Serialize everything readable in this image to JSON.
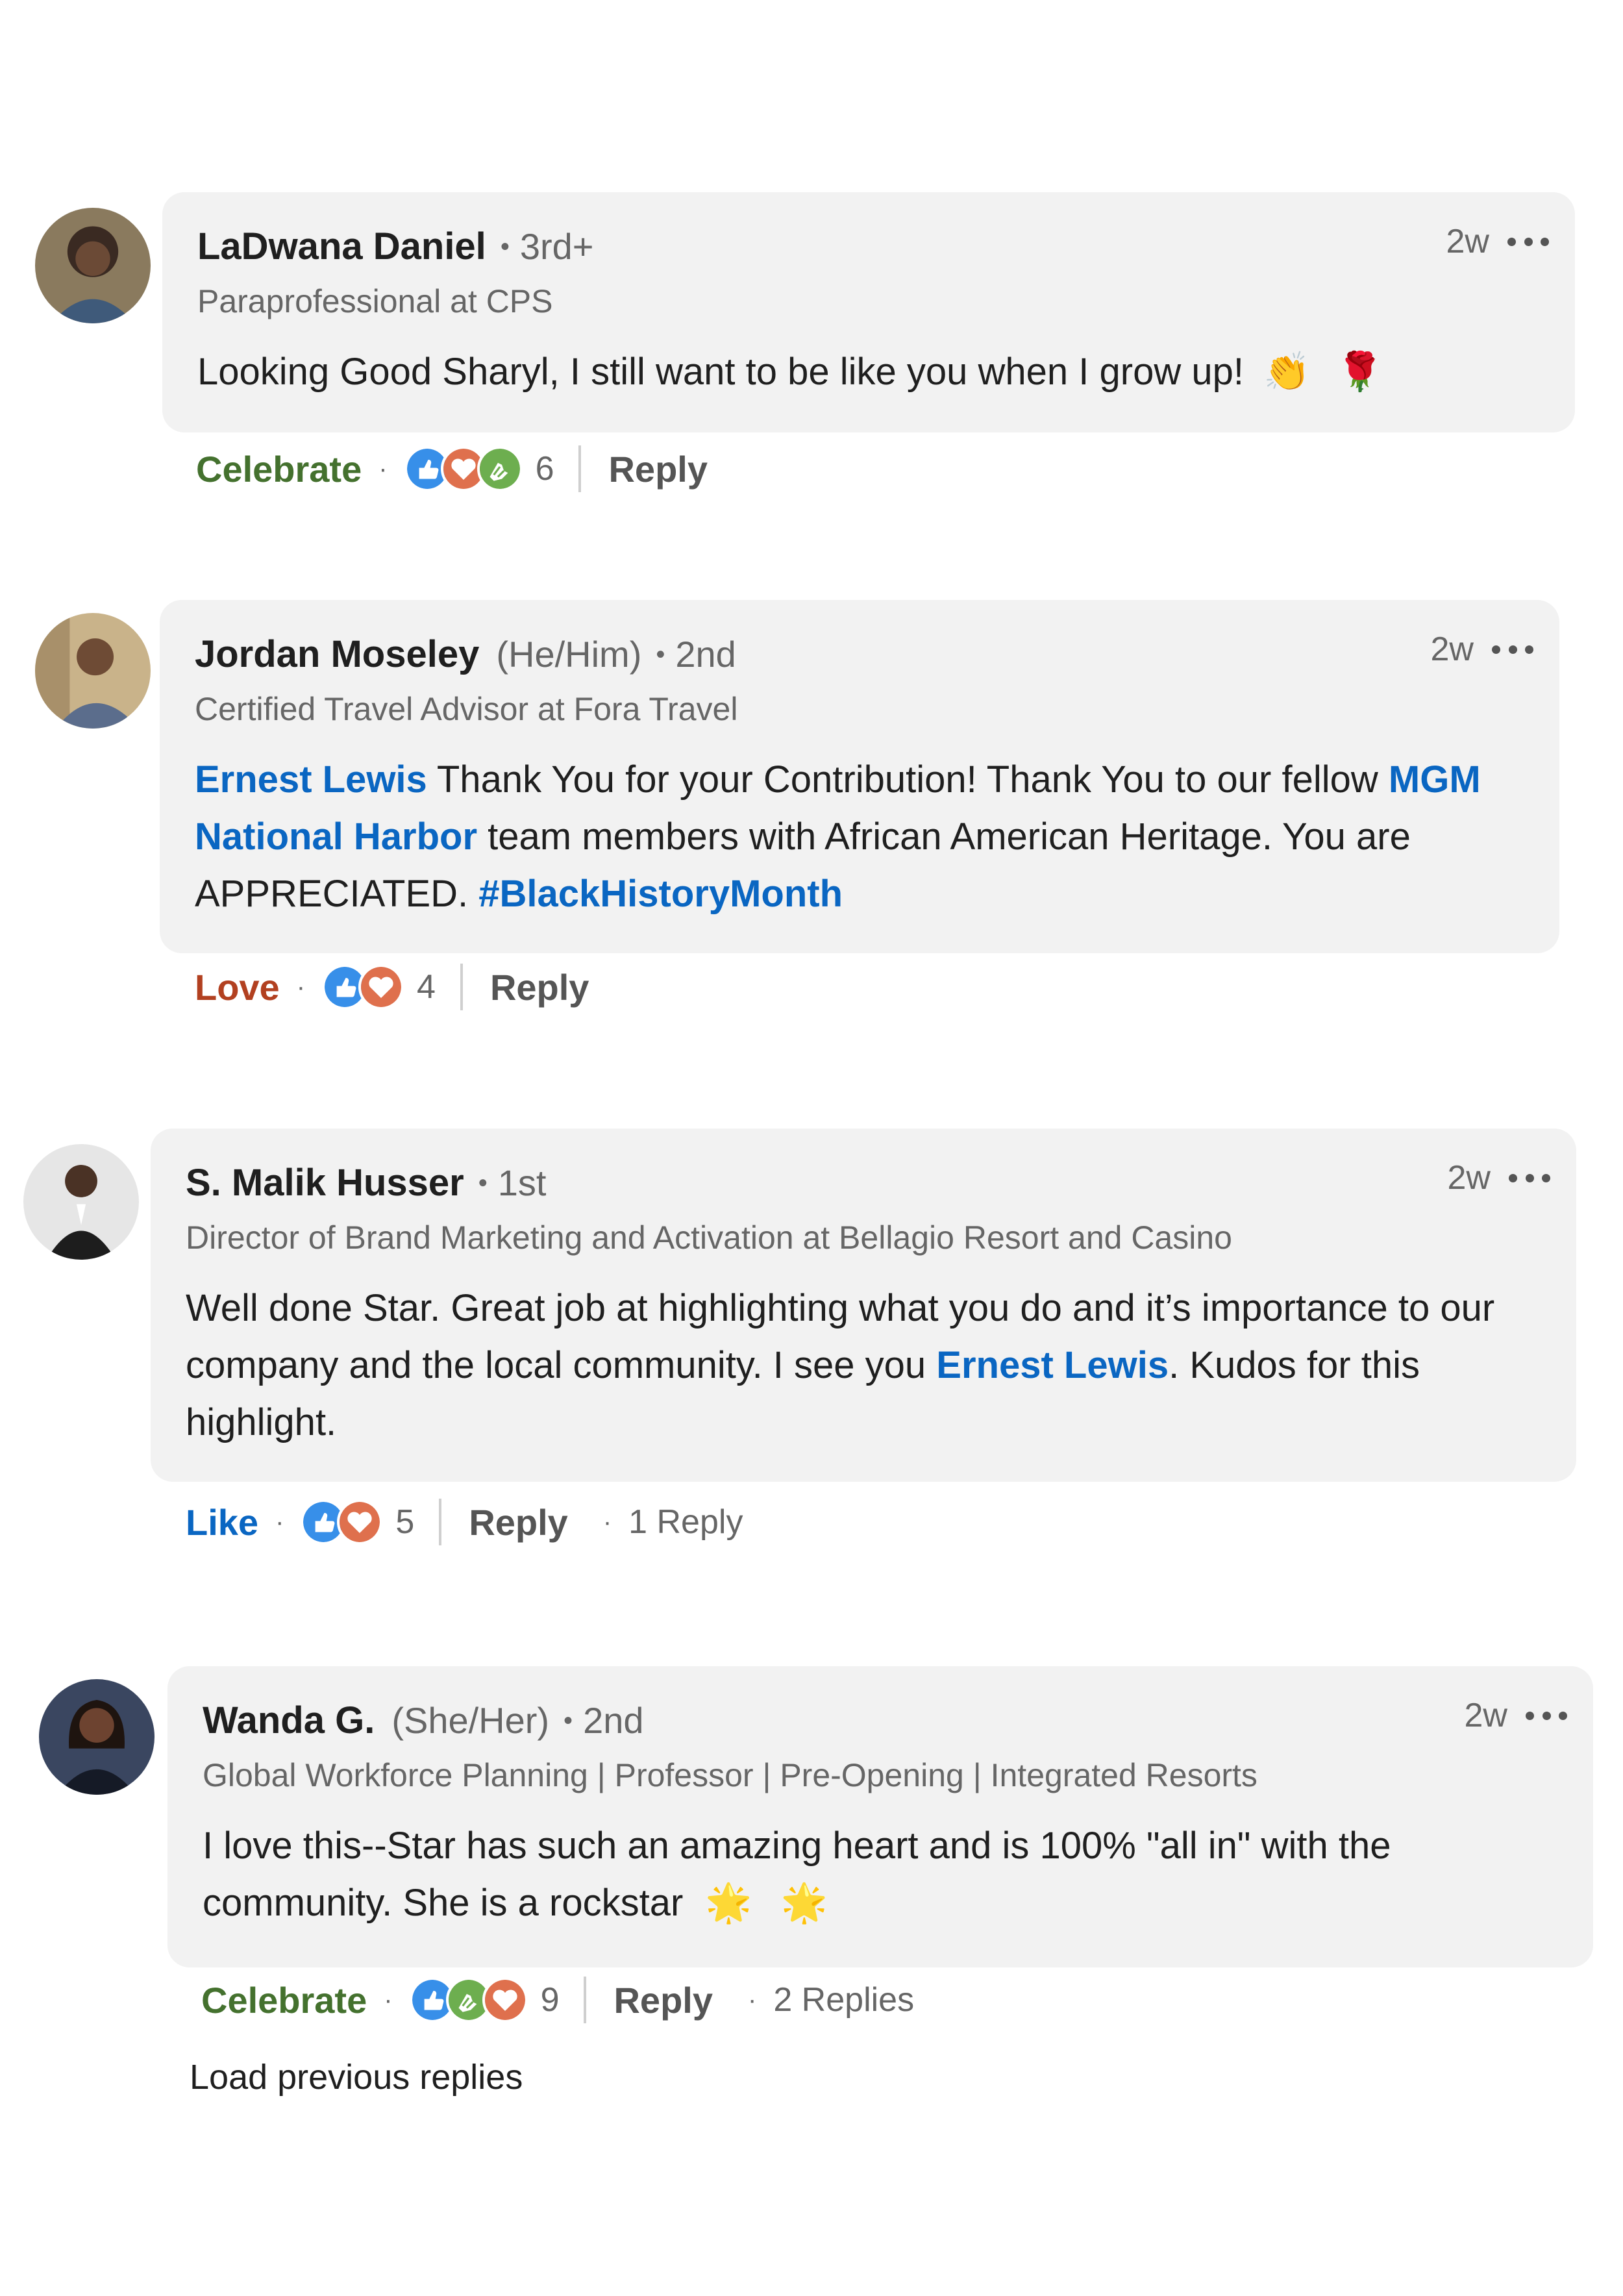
{
  "colors": {
    "bubble_bg": "#f2f2f2",
    "link": "#0a66c2",
    "celebrate": "#44712e",
    "love": "#b24020",
    "like": "#0a66c2",
    "muted": "#666666"
  },
  "comments": [
    {
      "name": "LaDwana Daniel",
      "pronouns": "",
      "degree": "3rd+",
      "subtitle": "Paraprofessional at CPS",
      "time": "2w",
      "text": "Looking Good Sharyl, I still want to be like you when I grow up!",
      "emojis": [
        "👏",
        "🌹"
      ],
      "reaction": "Celebrate",
      "reaction_icons": [
        "like",
        "love",
        "celebrate"
      ],
      "reaction_count": "6",
      "reply_label": "Reply",
      "replies": ""
    },
    {
      "name": "Jordan Moseley",
      "pronouns": "(He/Him)",
      "degree": "2nd",
      "subtitle": "Certified Travel Advisor at Fora Travel",
      "time": "2w",
      "text_parts": [
        {
          "t": "Ernest Lewis",
          "link": true
        },
        {
          "t": " Thank You for your Contribution! Thank You to our fellow ",
          "link": false
        },
        {
          "t": "MGM National Harbor",
          "link": true
        },
        {
          "t": " team members with African American Heritage. You are APPRECIATED. ",
          "link": false
        },
        {
          "t": "#BlackHistoryMonth",
          "link": true
        }
      ],
      "reaction": "Love",
      "reaction_icons": [
        "like",
        "love"
      ],
      "reaction_count": "4",
      "reply_label": "Reply",
      "replies": ""
    },
    {
      "name": "S. Malik Husser",
      "pronouns": "",
      "degree": "1st",
      "subtitle": "Director of Brand Marketing and Activation at Bellagio Resort and Casino",
      "time": "2w",
      "text_parts": [
        {
          "t": "Well done Star. Great job at highlighting what you do and it’s importance to our company and the local community. I see you ",
          "link": false
        },
        {
          "t": "Ernest Lewis",
          "link": true
        },
        {
          "t": ". Kudos for this highlight.",
          "link": false
        }
      ],
      "reaction": "Like",
      "reaction_icons": [
        "like",
        "love"
      ],
      "reaction_count": "5",
      "reply_label": "Reply",
      "replies": "1 Reply"
    },
    {
      "name": "Wanda G.",
      "pronouns": "(She/Her)",
      "degree": "2nd",
      "subtitle": "Global Workforce Planning | Professor | Pre-Opening | Integrated Resorts",
      "time": "2w",
      "text": "I love this--Star has such an amazing heart and is 100% \"all in\" with the community. She is a rockstar",
      "emojis": [
        "🌟",
        "🌟"
      ],
      "reaction": "Celebrate",
      "reaction_icons": [
        "like",
        "celebrate",
        "love"
      ],
      "reaction_count": "9",
      "reply_label": "Reply",
      "replies": "2 Replies"
    }
  ],
  "load_previous": "Load previous replies"
}
